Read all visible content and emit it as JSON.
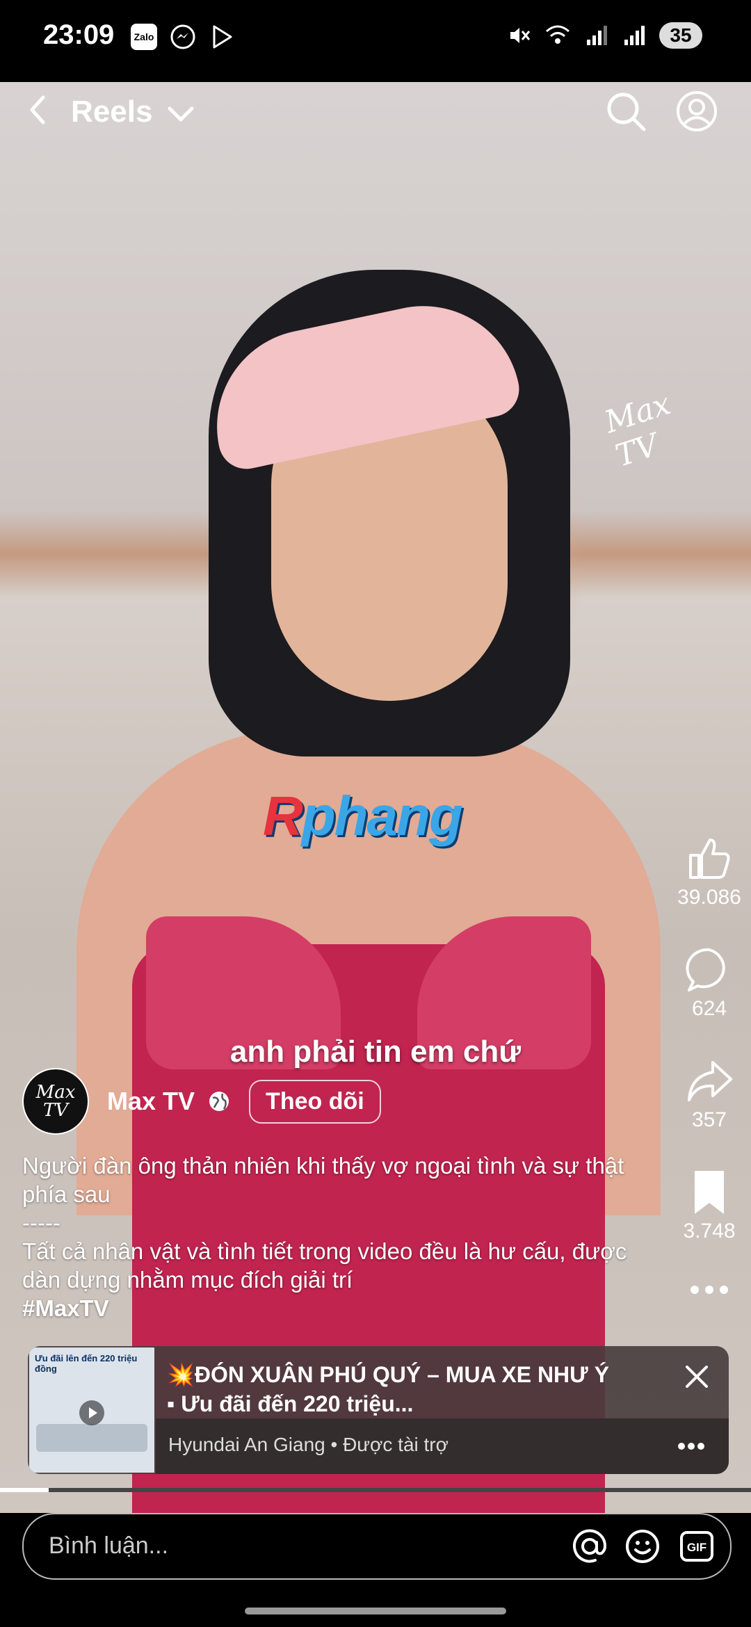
{
  "status_bar": {
    "time": "23:09",
    "app_icons": [
      "Zalo",
      "messenger-icon",
      "play-store-icon"
    ],
    "zalo_label": "Zalo",
    "battery_level": "35"
  },
  "header": {
    "title": "Reels"
  },
  "video": {
    "watermark_max": "Max TV",
    "watermark_rphang": "Rphang",
    "subtitle": "anh phải tin em chứ"
  },
  "actions": {
    "likes": "39.086",
    "comments": "624",
    "shares": "357",
    "saves": "3.748"
  },
  "author": {
    "name": "Max TV",
    "avatar_text": "Max TV",
    "follow_label": "Theo dõi"
  },
  "caption": {
    "line1": "Người đàn ông thản nhiên khi thấy vợ ngoại tình và sự thật phía sau",
    "separator": "-----",
    "line2": "Tất cả nhân vật và tình tiết trong video đều là hư cấu, được dàn dựng nhằm mục đích giải trí",
    "hashtag": "#MaxTV"
  },
  "ad": {
    "headline_line1": "💥ĐÓN XUÂN PHÚ QUÝ – MUA XE NHƯ Ý",
    "headline_line2": "▪ Ưu đãi đến 220 triệu...",
    "sponsor": "Hyundai An Giang • Được tài trợ",
    "thumb_text": "Ưu đãi lên đến 220 triệu đồng"
  },
  "progress": {
    "fraction": 0.065
  },
  "comment": {
    "placeholder": "Bình luận..."
  },
  "colors": {
    "like": "#ffffff",
    "dress": "#c0244f",
    "rphang_blue": "#3aa6e8",
    "rphang_red": "#e7333d"
  }
}
